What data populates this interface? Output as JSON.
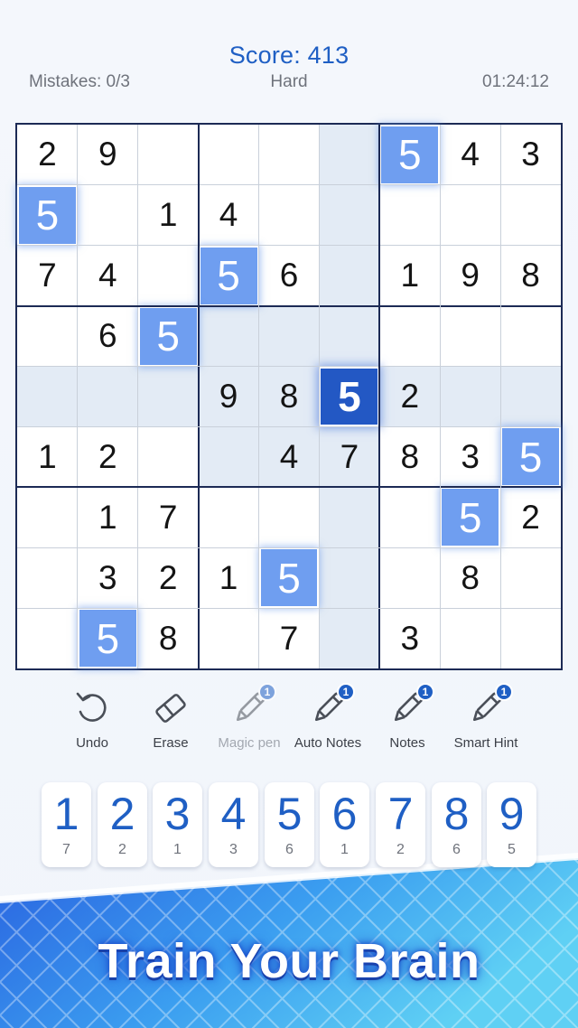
{
  "header": {
    "score": "Score: 413",
    "mistakes": "Mistakes: 0/3",
    "difficulty": "Hard",
    "timer": "01:24:12"
  },
  "board": {
    "selected": {
      "row": 4,
      "col": 5
    },
    "rows": [
      [
        "2",
        "9",
        "",
        "",
        "",
        "",
        "5",
        "4",
        "3"
      ],
      [
        "5",
        "",
        "1",
        "4",
        "",
        "",
        "",
        "",
        ""
      ],
      [
        "7",
        "4",
        "",
        "5",
        "6",
        "",
        "1",
        "9",
        "8"
      ],
      [
        "",
        "6",
        "5",
        "",
        "",
        "",
        "",
        "",
        ""
      ],
      [
        "",
        "",
        "",
        "9",
        "8",
        "5",
        "2",
        "",
        ""
      ],
      [
        "1",
        "2",
        "",
        "",
        "4",
        "7",
        "8",
        "3",
        "5"
      ],
      [
        "",
        "1",
        "7",
        "",
        "",
        "",
        "",
        "5",
        "2"
      ],
      [
        "",
        "3",
        "2",
        "1",
        "5",
        "",
        "",
        "8",
        ""
      ],
      [
        "",
        "5",
        "8",
        "",
        "7",
        "",
        "3",
        "",
        ""
      ]
    ]
  },
  "tools": [
    {
      "label": "Undo",
      "icon": "undo-icon",
      "badge": "",
      "disabled": false
    },
    {
      "label": "Erase",
      "icon": "eraser-icon",
      "badge": "",
      "disabled": false
    },
    {
      "label": "Magic pen",
      "icon": "pencil-icon",
      "badge": "1",
      "disabled": true
    },
    {
      "label": "Auto Notes",
      "icon": "pencil-icon",
      "badge": "1",
      "disabled": false
    },
    {
      "label": "Notes",
      "icon": "pencil-icon",
      "badge": "1",
      "disabled": false
    },
    {
      "label": "Smart Hint",
      "icon": "pencil-icon",
      "badge": "1",
      "disabled": false
    }
  ],
  "numpad": [
    {
      "num": "1",
      "count": "7"
    },
    {
      "num": "2",
      "count": "2"
    },
    {
      "num": "3",
      "count": "1"
    },
    {
      "num": "4",
      "count": "3"
    },
    {
      "num": "5",
      "count": "6"
    },
    {
      "num": "6",
      "count": "1"
    },
    {
      "num": "7",
      "count": "2"
    },
    {
      "num": "8",
      "count": "6"
    },
    {
      "num": "9",
      "count": "5"
    }
  ],
  "banner": {
    "title": "Train Your Brain"
  },
  "colors": {
    "accent": "#1f5fc4",
    "highlight": "#e3ebf5",
    "five_cell": "#6f9ef0",
    "selected_cell": "#2358c4",
    "grid_thick": "#1c2a55"
  }
}
